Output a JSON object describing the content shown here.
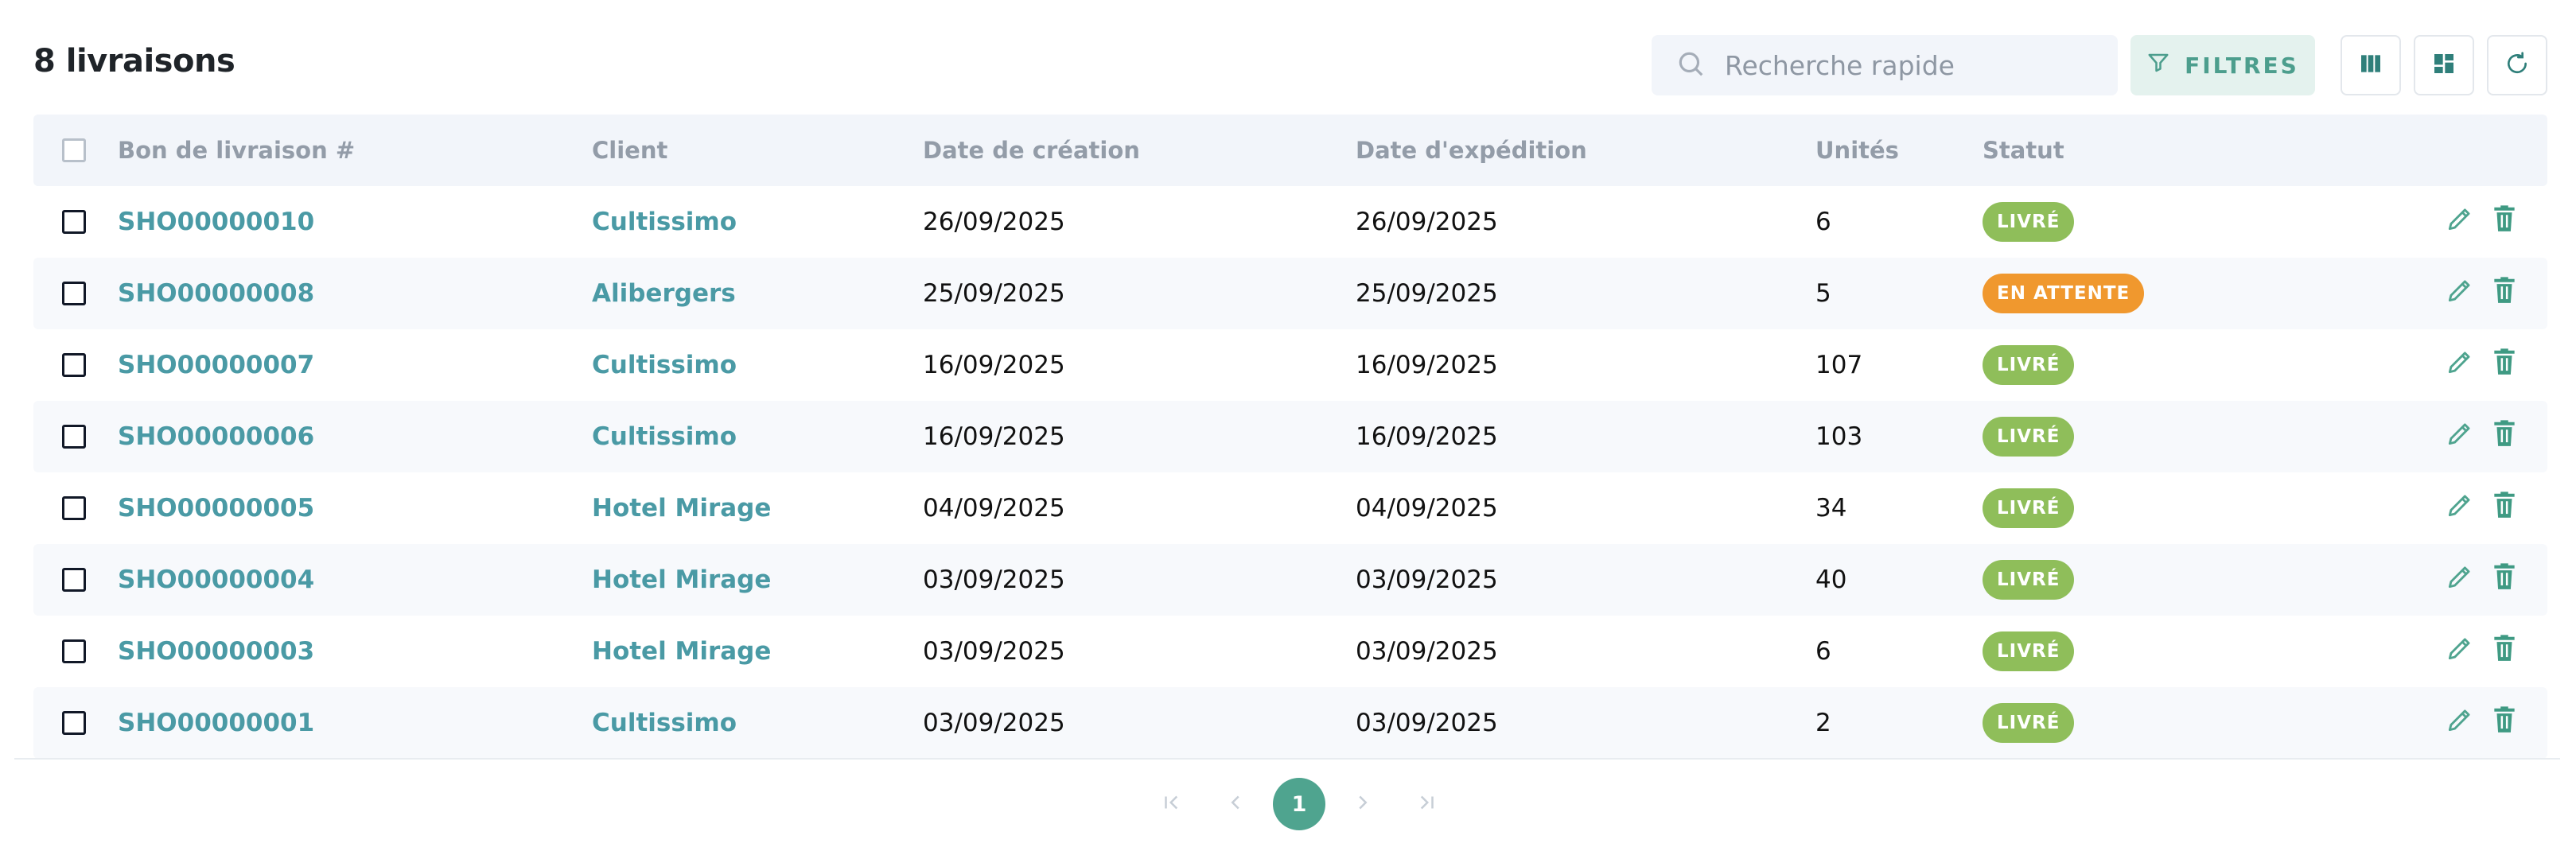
{
  "page": {
    "title": "8 livraisons"
  },
  "toolbar": {
    "search_placeholder": "Recherche rapide",
    "filters_label": "FILTRES"
  },
  "table": {
    "headers": {
      "number": "Bon de livraison #",
      "client": "Client",
      "created": "Date de création",
      "shipped": "Date d'expédition",
      "units": "Unités",
      "status": "Statut"
    },
    "rows": [
      {
        "number": "SHO00000010",
        "client": "Cultissimo",
        "created": "26/09/2025",
        "shipped": "26/09/2025",
        "units": "6",
        "status": "LIVRÉ"
      },
      {
        "number": "SHO00000008",
        "client": "Alibergers",
        "created": "25/09/2025",
        "shipped": "25/09/2025",
        "units": "5",
        "status": "EN ATTENTE"
      },
      {
        "number": "SHO00000007",
        "client": "Cultissimo",
        "created": "16/09/2025",
        "shipped": "16/09/2025",
        "units": "107",
        "status": "LIVRÉ"
      },
      {
        "number": "SHO00000006",
        "client": "Cultissimo",
        "created": "16/09/2025",
        "shipped": "16/09/2025",
        "units": "103",
        "status": "LIVRÉ"
      },
      {
        "number": "SHO00000005",
        "client": "Hotel Mirage",
        "created": "04/09/2025",
        "shipped": "04/09/2025",
        "units": "34",
        "status": "LIVRÉ"
      },
      {
        "number": "SHO00000004",
        "client": "Hotel Mirage",
        "created": "03/09/2025",
        "shipped": "03/09/2025",
        "units": "40",
        "status": "LIVRÉ"
      },
      {
        "number": "SHO00000003",
        "client": "Hotel Mirage",
        "created": "03/09/2025",
        "shipped": "03/09/2025",
        "units": "6",
        "status": "LIVRÉ"
      },
      {
        "number": "SHO00000001",
        "client": "Cultissimo",
        "created": "03/09/2025",
        "shipped": "03/09/2025",
        "units": "2",
        "status": "LIVRÉ"
      }
    ]
  },
  "pagination": {
    "current_page": "1"
  },
  "colors": {
    "accent": "#4fa48f",
    "link": "#4a9aa5",
    "status_done": "#8fbe5a",
    "status_pending": "#f0982e"
  },
  "icons": [
    "search-icon",
    "filter-icon",
    "columns-icon",
    "layout-icon",
    "refresh-icon",
    "pencil-icon",
    "trash-icon",
    "first-page-icon",
    "prev-page-icon",
    "next-page-icon",
    "last-page-icon"
  ]
}
